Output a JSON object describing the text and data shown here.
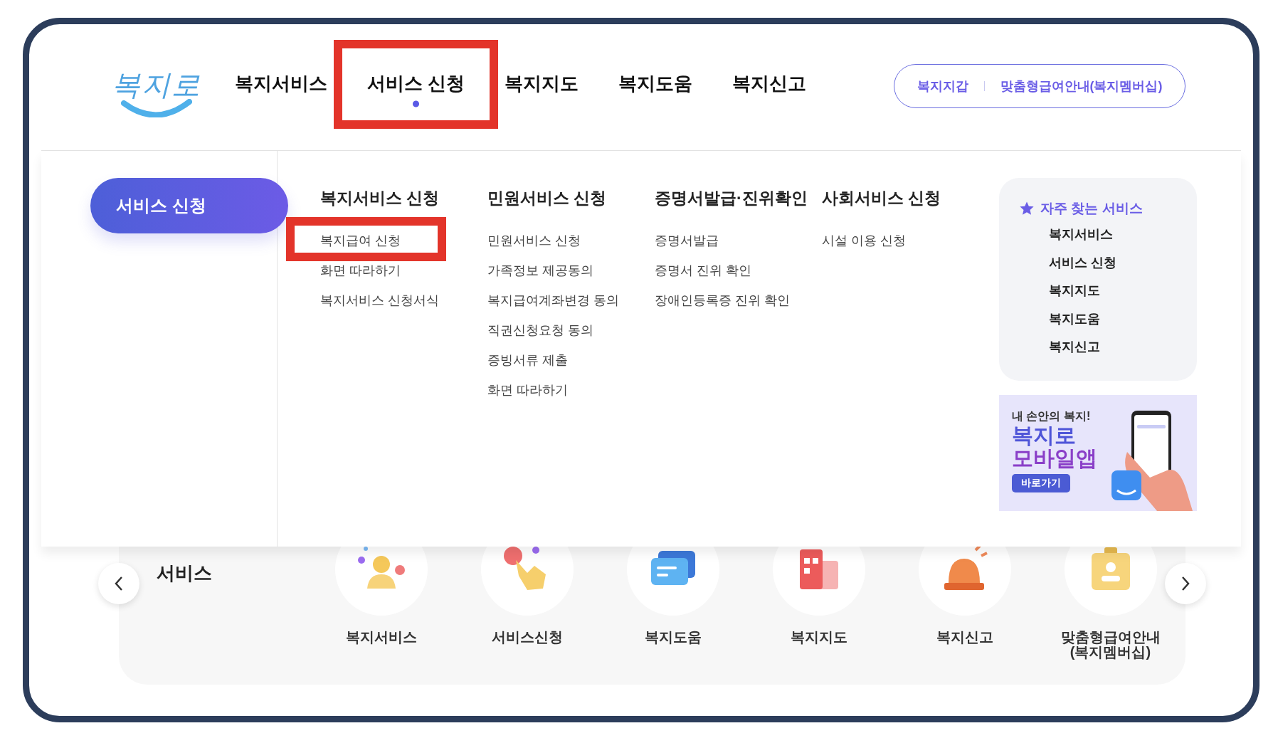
{
  "logo": {
    "text": "복지로"
  },
  "nav": [
    {
      "label": "복지서비스",
      "selected": false,
      "highlighted": false
    },
    {
      "label": "서비스 신청",
      "selected": true,
      "highlighted": true
    },
    {
      "label": "복지지도",
      "selected": false,
      "highlighted": false
    },
    {
      "label": "복지도움",
      "selected": false,
      "highlighted": false
    },
    {
      "label": "복지신고",
      "selected": false,
      "highlighted": false
    }
  ],
  "quick_links": [
    "복지지갑",
    "맞춤형급여안내(복지멤버십)"
  ],
  "dropdown": {
    "title": "서비스 신청",
    "columns": [
      {
        "heading": "복지서비스 신청",
        "items": [
          {
            "label": "복지급여 신청",
            "highlighted": true
          },
          {
            "label": "화면 따라하기",
            "highlighted": false
          },
          {
            "label": "복지서비스 신청서식",
            "highlighted": false
          }
        ]
      },
      {
        "heading": "민원서비스 신청",
        "items": [
          {
            "label": "민원서비스 신청",
            "highlighted": false
          },
          {
            "label": "가족정보 제공동의",
            "highlighted": false
          },
          {
            "label": "복지급여계좌변경 동의",
            "highlighted": false
          },
          {
            "label": "직권신청요청 동의",
            "highlighted": false
          },
          {
            "label": "증빙서류 제출",
            "highlighted": false
          },
          {
            "label": "화면 따라하기",
            "highlighted": false
          }
        ]
      },
      {
        "heading": "증명서발급·진위확인",
        "items": [
          {
            "label": "증명서발급",
            "highlighted": false
          },
          {
            "label": "증명서 진위 확인",
            "highlighted": false
          },
          {
            "label": "장애인등록증 진위 확인",
            "highlighted": false
          }
        ]
      },
      {
        "heading": "사회서비스 신청",
        "items": [
          {
            "label": "시설 이용 신청",
            "highlighted": false
          }
        ]
      }
    ]
  },
  "favorites": {
    "title": "자주 찾는 서비스",
    "items": [
      "복지서비스",
      "서비스 신청",
      "복지지도",
      "복지도움",
      "복지신고"
    ]
  },
  "banner": {
    "tagline": "내 손안의 복지!",
    "headline": [
      "복지로",
      "모바일앱"
    ],
    "button": "바로가기"
  },
  "frequent": {
    "title": "서비스",
    "items": [
      "복지서비스",
      "서비스신청",
      "복지도움",
      "복지지도",
      "복지신고",
      "맞춤형급여안내\n(복지멤버십)"
    ]
  }
}
